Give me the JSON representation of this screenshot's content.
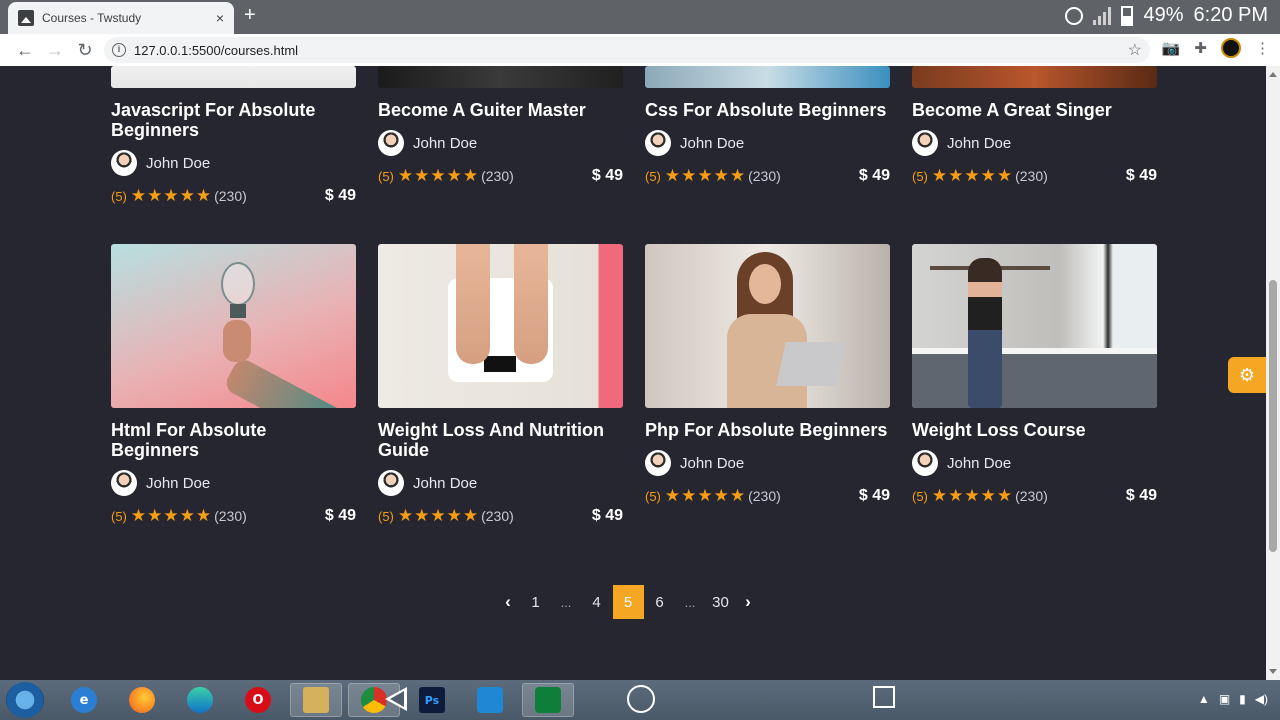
{
  "browser": {
    "tab_title": "Courses - Twstudy",
    "tab_close": "×",
    "new_tab": "+",
    "url": "127.0.0.1:5500/courses.html",
    "back": "←",
    "forward": "→",
    "reload": "↻",
    "bookmark": "☆",
    "camera": "📷",
    "extensions": "✚",
    "menu": "⋮"
  },
  "status_bar": {
    "battery_percent": "49%",
    "time": "6:20 PM"
  },
  "courses": [
    {
      "title": "Javascript For Absolute Beginners",
      "author": "John Doe",
      "rating": "(5)",
      "stars": "★★★★★",
      "reviews": "(230)",
      "price": "$ 49"
    },
    {
      "title": "Become A Guiter Master",
      "author": "John Doe",
      "rating": "(5)",
      "stars": "★★★★★",
      "reviews": "(230)",
      "price": "$ 49"
    },
    {
      "title": "Css For Absolute Beginners",
      "author": "John Doe",
      "rating": "(5)",
      "stars": "★★★★★",
      "reviews": "(230)",
      "price": "$ 49"
    },
    {
      "title": "Become A Great Singer",
      "author": "John Doe",
      "rating": "(5)",
      "stars": "★★★★★",
      "reviews": "(230)",
      "price": "$ 49"
    },
    {
      "title": "Html For Absolute Beginners",
      "author": "John Doe",
      "rating": "(5)",
      "stars": "★★★★★",
      "reviews": "(230)",
      "price": "$ 49"
    },
    {
      "title": "Weight Loss And Nutrition Guide",
      "author": "John Doe",
      "rating": "(5)",
      "stars": "★★★★★",
      "reviews": "(230)",
      "price": "$ 49"
    },
    {
      "title": "Php For Absolute Beginners",
      "author": "John Doe",
      "rating": "(5)",
      "stars": "★★★★★",
      "reviews": "(230)",
      "price": "$ 49"
    },
    {
      "title": "Weight Loss Course",
      "author": "John Doe",
      "rating": "(5)",
      "stars": "★★★★★",
      "reviews": "(230)",
      "price": "$ 49"
    }
  ],
  "pagination": {
    "prev": "‹",
    "pages": [
      "1",
      "...",
      "4",
      "5",
      "6",
      "...",
      "30"
    ],
    "active": "5",
    "next": "›"
  },
  "settings_icon": "⚙",
  "taskbar": {
    "apps": [
      "internet-explorer-icon",
      "firefox-icon",
      "edge-icon",
      "opera-icon",
      "file-explorer-icon",
      "chrome-icon",
      "photoshop-icon",
      "vscode-icon",
      "camtasia-icon"
    ],
    "photoshop_label": "Ps"
  },
  "colors": {
    "accent": "#f5a623",
    "background": "#262630"
  }
}
